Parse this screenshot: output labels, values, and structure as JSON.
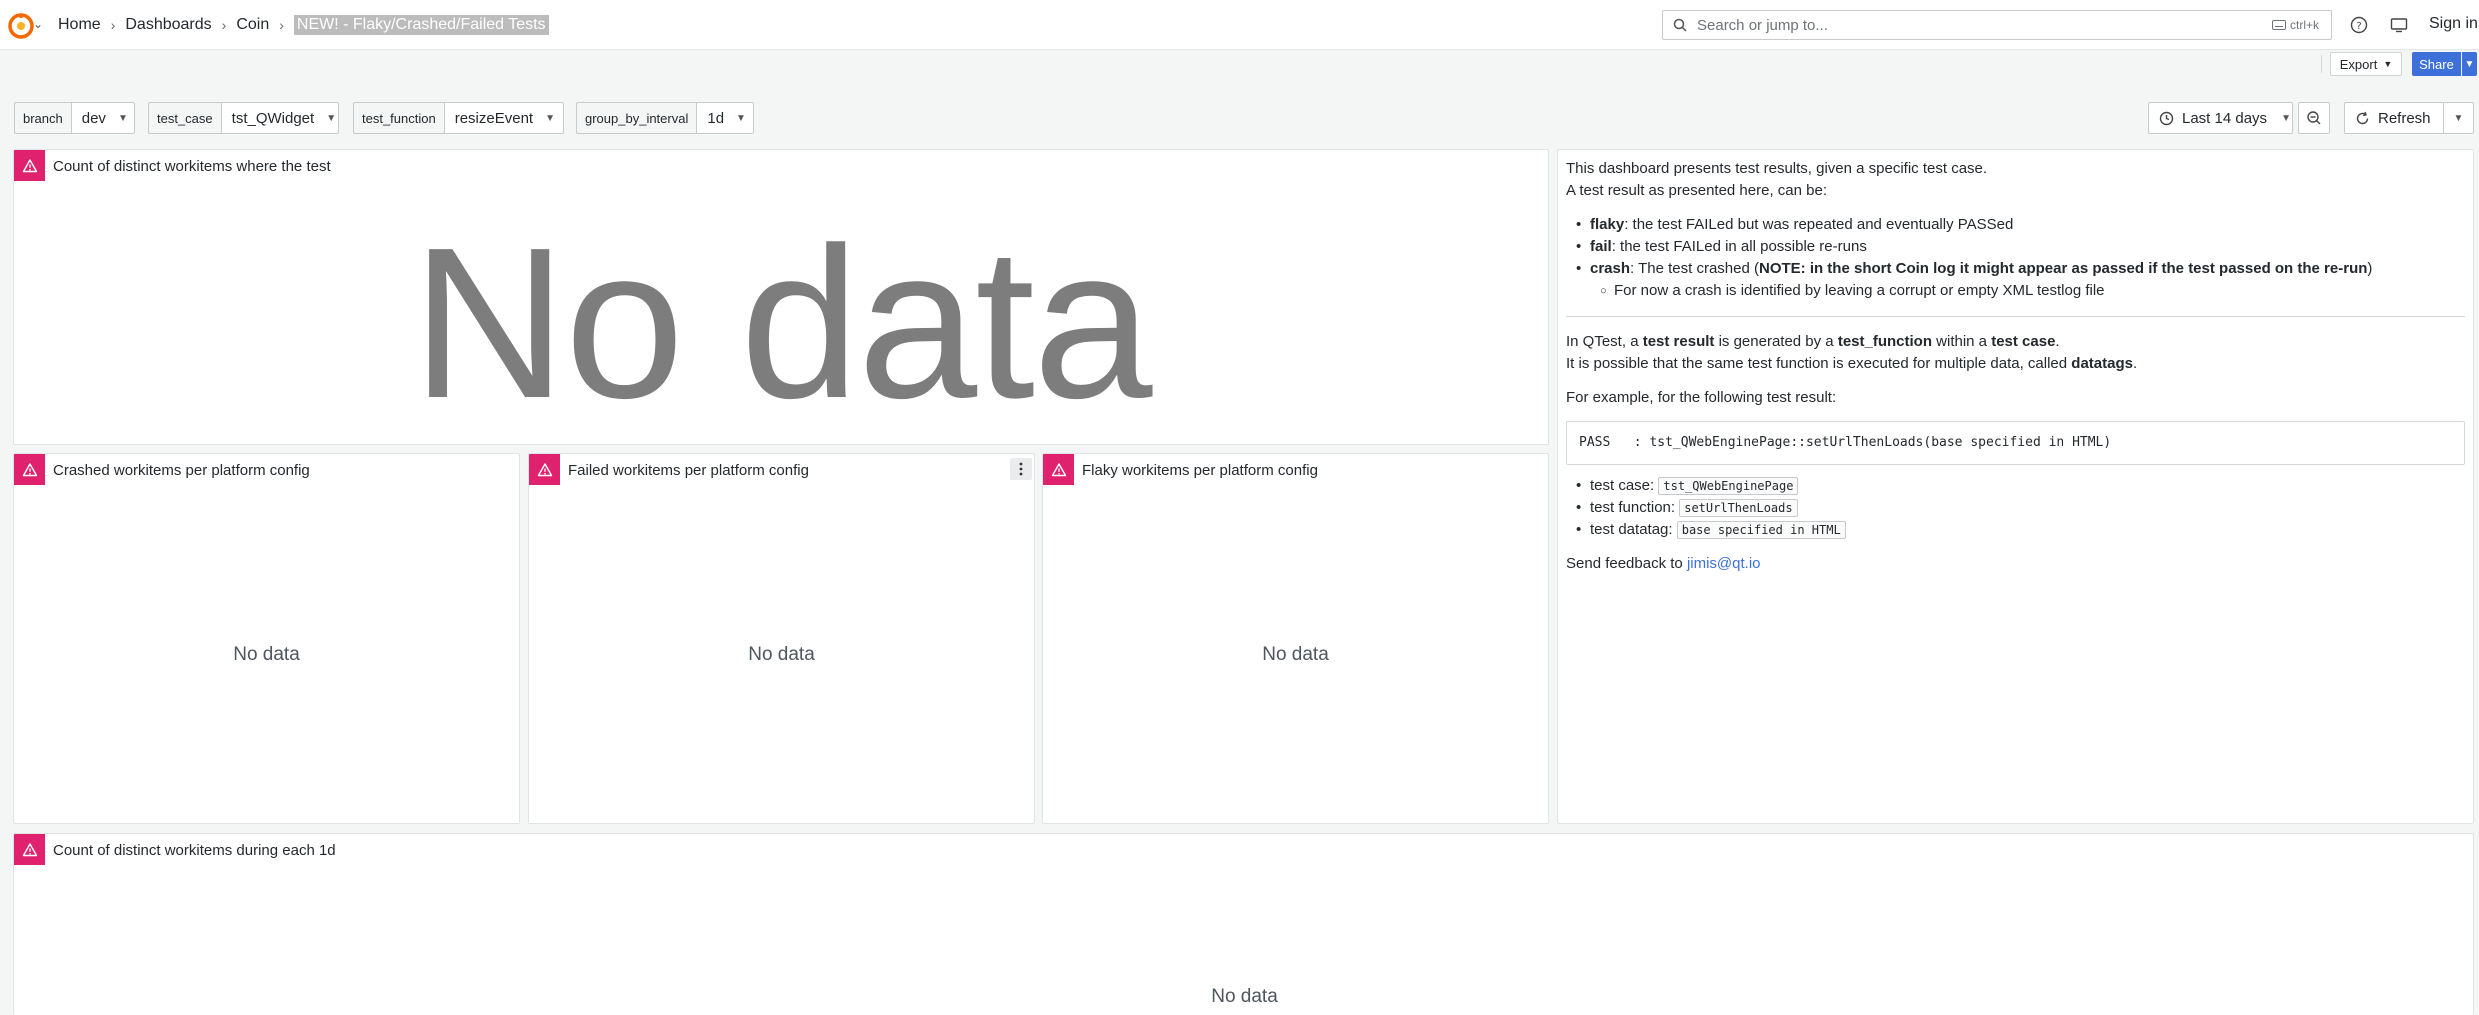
{
  "nav": {
    "breadcrumbs": [
      "Home",
      "Dashboards",
      "Coin",
      "NEW! - Flaky/Crashed/Failed Tests"
    ],
    "search_placeholder": "Search or jump to...",
    "search_shortcut": "ctrl+k",
    "sign_in": "Sign in"
  },
  "actions": {
    "export_label": "Export",
    "share_label": "Share"
  },
  "variables": [
    {
      "label": "branch",
      "value": "dev"
    },
    {
      "label": "test_case",
      "value": "tst_QWidget"
    },
    {
      "label": "test_function",
      "value": "resizeEvent"
    },
    {
      "label": "group_by_interval",
      "value": "1d"
    }
  ],
  "time": {
    "range_label": "Last 14 days",
    "refresh_label": "Refresh"
  },
  "panels": {
    "top": {
      "title": "Count of distinct workitems where the test",
      "nodata": "No data"
    },
    "crashed": {
      "title": "Crashed workitems per platform config",
      "nodata": "No data"
    },
    "failed": {
      "title": "Failed workitems per platform config",
      "nodata": "No data"
    },
    "flaky": {
      "title": "Flaky workitems per platform config",
      "nodata": "No data"
    },
    "bottom": {
      "title": "Count of distinct workitems during each 1d",
      "nodata": "No data"
    }
  },
  "text_panel": {
    "intro1": "This dashboard presents test results, given a specific test case.",
    "intro2": "A test result as presented here, can be:",
    "flaky_term": "flaky",
    "flaky_desc": ": the test FAILed but was repeated and eventually PASSed",
    "fail_term": "fail",
    "fail_desc": ": the test FAILed in all possible re-runs",
    "crash_term": "crash",
    "crash_desc": ": The test crashed (",
    "crash_note": "NOTE: in the short Coin log it might appear as passed if the test passed on the re-run",
    "crash_close": ")",
    "crash_sub": "For now a crash is identified by leaving a corrupt or empty XML testlog file",
    "qtest_1": "In QTest, a ",
    "qtest_term1": "test result",
    "qtest_2": " is generated by a ",
    "qtest_term2": "test_function",
    "qtest_3": " within a ",
    "qtest_term3": "test case",
    "qtest_4": ".",
    "data_1": "It is possible that the same test function is executed for multiple data, called ",
    "data_term": "datatags",
    "data_2": ".",
    "example_intro": "For example, for the following test result:",
    "example_code": "PASS   : tst_QWebEnginePage::setUrlThenLoads(base specified in HTML)",
    "ex_case_label": "test case: ",
    "ex_case_value": "tst_QWebEnginePage",
    "ex_func_label": "test function: ",
    "ex_func_value": "setUrlThenLoads",
    "ex_tag_label": "test datatag: ",
    "ex_tag_value": "base specified in HTML",
    "feedback_text": "Send feedback to ",
    "feedback_email": "jimis@qt.io"
  },
  "colors": {
    "accent": "#3d71d9",
    "error": "#e0226e",
    "logo": "#f46800"
  }
}
